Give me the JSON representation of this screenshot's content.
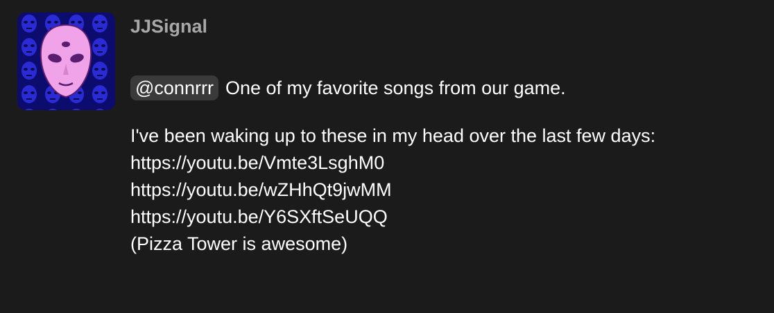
{
  "message": {
    "username": "JJSignal",
    "mention": "@connrrr",
    "first_line_text": "One of my favorite songs from our game.",
    "intro_text": "I've been waking up to these in my head over the last few days:",
    "links": [
      "https://youtu.be/Vmte3LsghM0",
      "https://youtu.be/wZHhQt9jwMM",
      "https://youtu.be/Y6SXftSeUQQ"
    ],
    "closing_text": "(Pizza Tower is awesome)"
  },
  "colors": {
    "background": "#1b1b1b",
    "username": "#a8a8a8",
    "mention_bg": "#3a3a3a",
    "text": "#ffffff",
    "avatar_bg": "#0c0c6e",
    "avatar_face": "#f0a3e8"
  }
}
